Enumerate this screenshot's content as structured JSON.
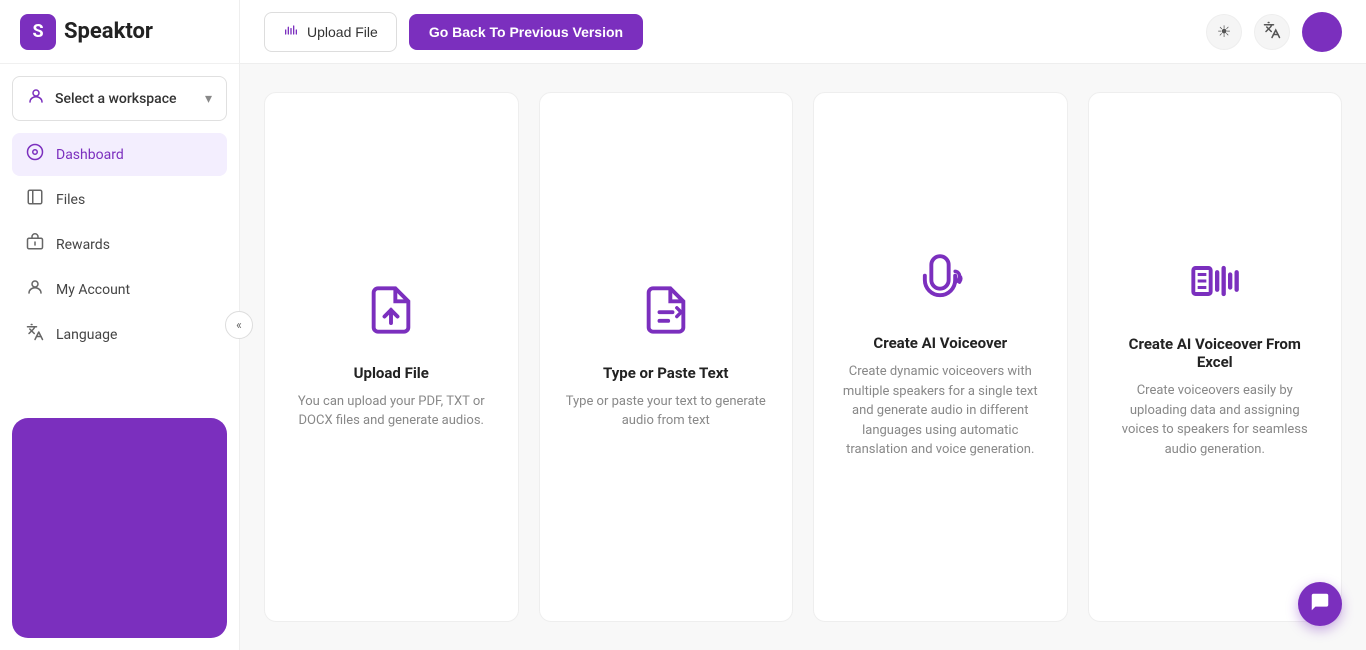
{
  "logo": {
    "letter": "S",
    "text": "Speaktor"
  },
  "sidebar": {
    "workspace": {
      "label": "Select a workspace",
      "chevron": "▾"
    },
    "nav_items": [
      {
        "id": "dashboard",
        "label": "Dashboard",
        "icon": "dashboard",
        "active": true
      },
      {
        "id": "files",
        "label": "Files",
        "icon": "files",
        "active": false
      },
      {
        "id": "rewards",
        "label": "Rewards",
        "icon": "rewards",
        "active": false
      },
      {
        "id": "my-account",
        "label": "My Account",
        "icon": "account",
        "active": false
      },
      {
        "id": "language",
        "label": "Language",
        "icon": "language",
        "active": false
      }
    ],
    "collapse_icon": "«"
  },
  "header": {
    "upload_file_label": "Upload File",
    "go_back_label": "Go Back To Previous Version"
  },
  "cards": [
    {
      "id": "upload-file",
      "title": "Upload File",
      "description": "You can upload your PDF, TXT or DOCX files and generate audios.",
      "icon_type": "upload-file"
    },
    {
      "id": "type-paste",
      "title": "Type or Paste Text",
      "description": "Type or paste your text to generate audio from text",
      "icon_type": "type-paste"
    },
    {
      "id": "ai-voiceover",
      "title": "Create AI Voiceover",
      "description": "Create dynamic voiceovers with multiple speakers for a single text and generate audio in different languages using automatic translation and voice generation.",
      "icon_type": "ai-voiceover"
    },
    {
      "id": "ai-voiceover-excel",
      "title": "Create AI Voiceover From Excel",
      "description": "Create voiceovers easily by uploading data and assigning voices to speakers for seamless audio generation.",
      "icon_type": "ai-voiceover-excel"
    }
  ],
  "chat_bubble_icon": "💬"
}
